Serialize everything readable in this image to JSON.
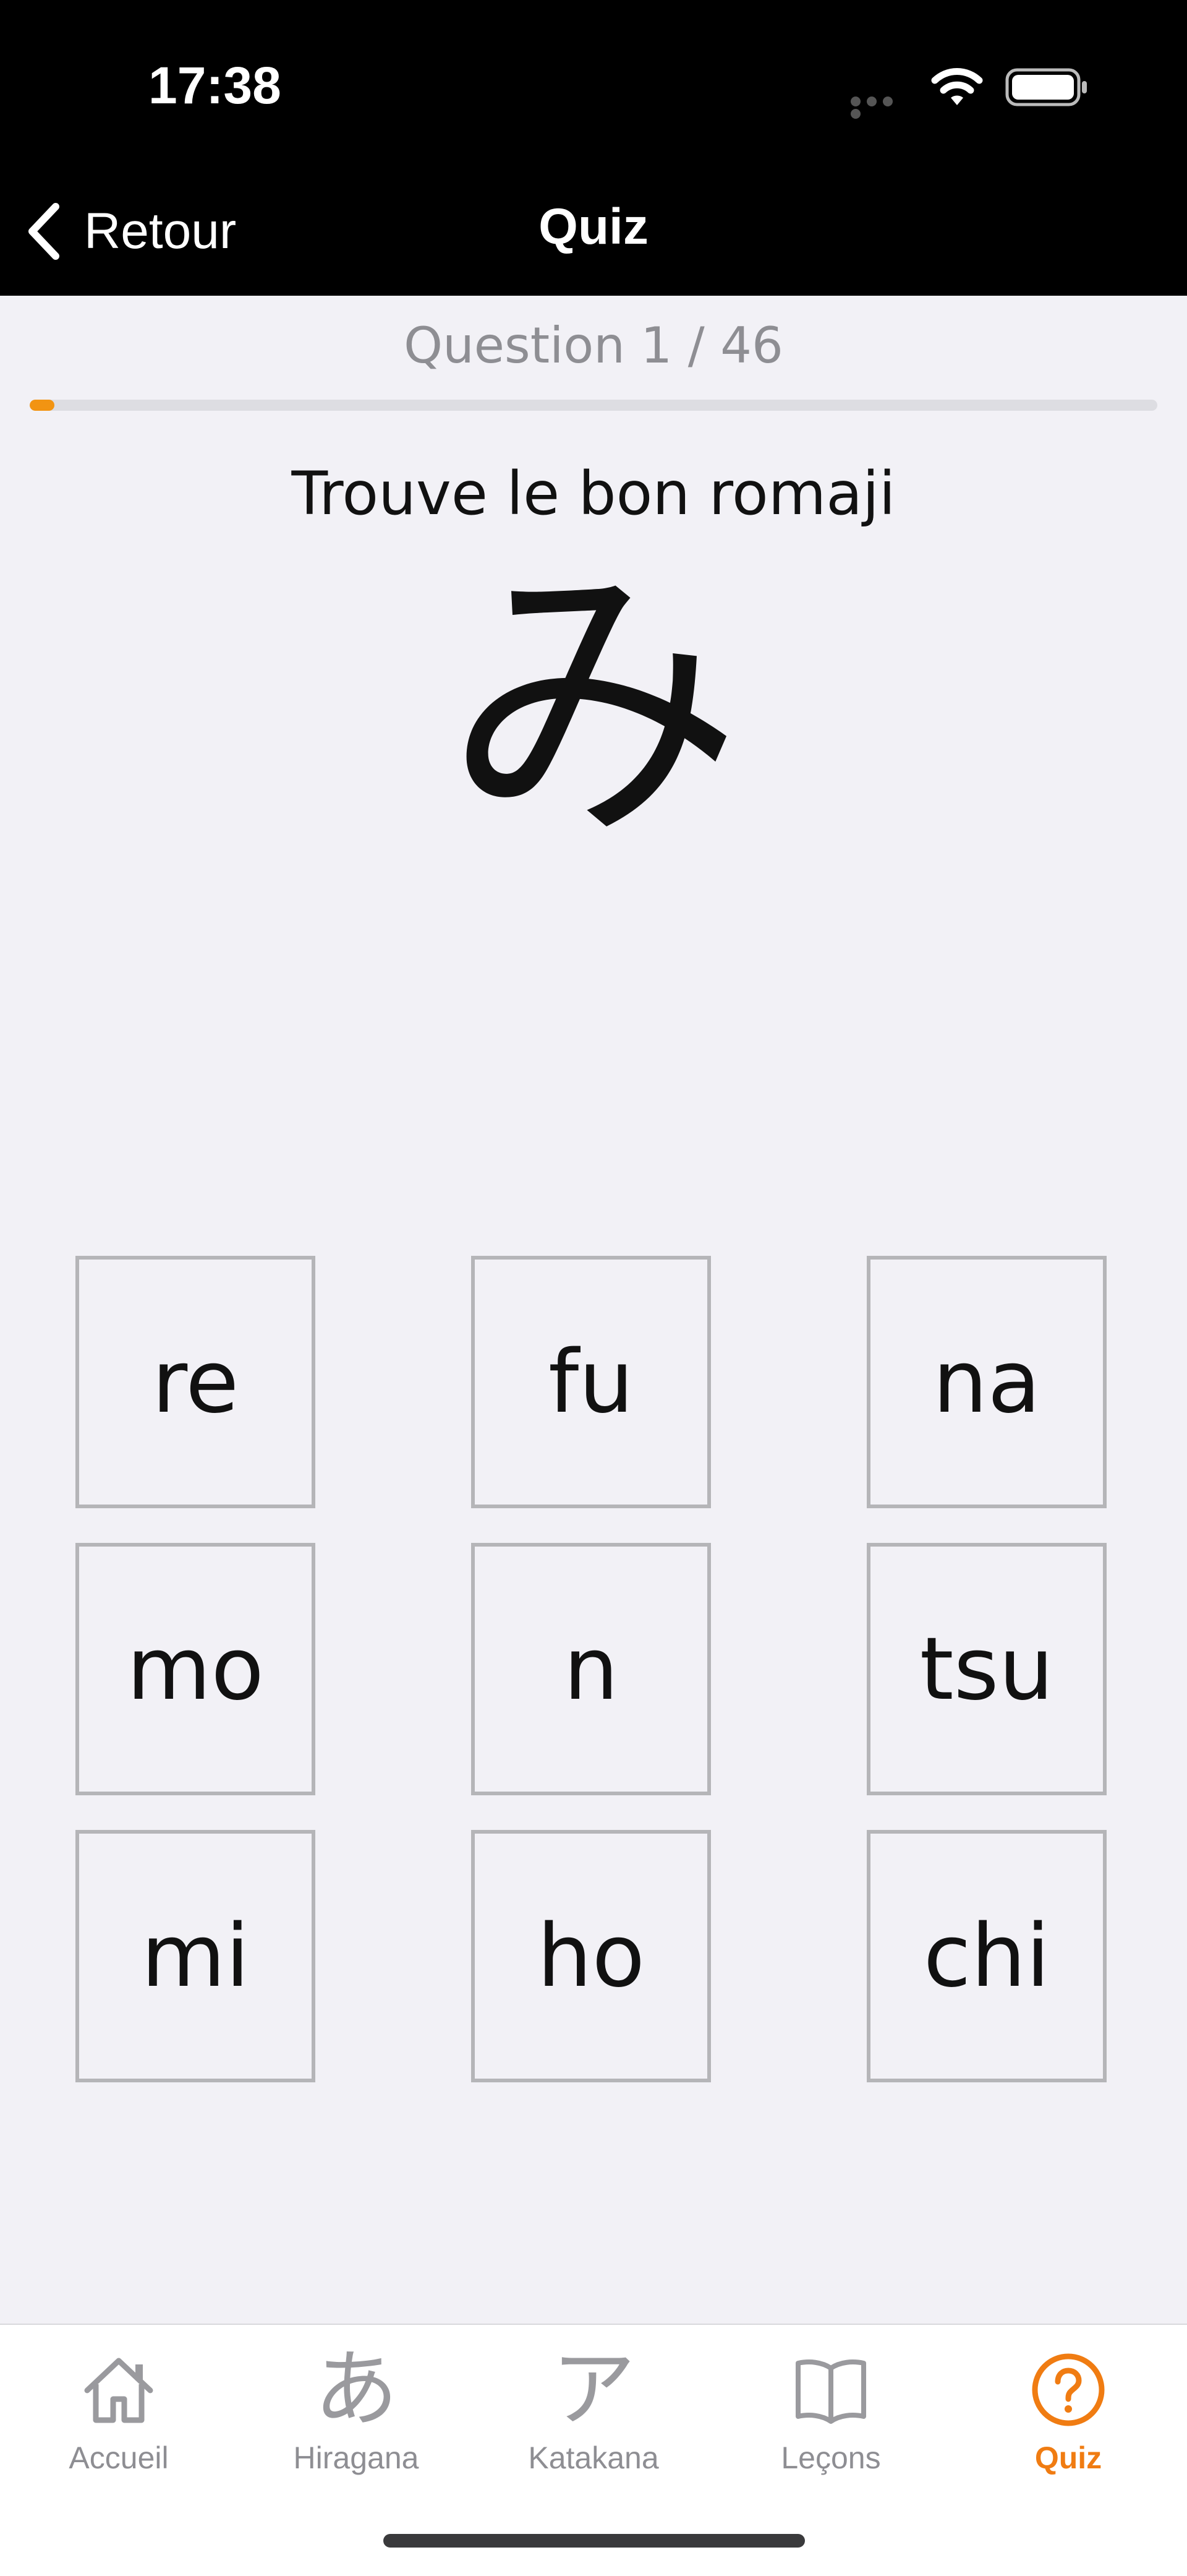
{
  "status": {
    "time": "17:38"
  },
  "nav": {
    "back_label": "Retour",
    "title": "Quiz"
  },
  "quiz": {
    "counter": "Question 1 / 46",
    "progress_fraction": 0.0217,
    "prompt": "Trouve le bon romaji",
    "kana": "み",
    "answers": [
      "re",
      "fu",
      "na",
      "mo",
      "n",
      "tsu",
      "mi",
      "ho",
      "chi"
    ]
  },
  "tabs": [
    {
      "label": "Accueil",
      "icon": "home-icon",
      "active": false
    },
    {
      "label": "Hiragana",
      "icon": "hiragana-a-icon",
      "glyph": "あ",
      "active": false
    },
    {
      "label": "Katakana",
      "icon": "katakana-a-icon",
      "glyph": "ア",
      "active": false
    },
    {
      "label": "Leçons",
      "icon": "book-icon",
      "active": false
    },
    {
      "label": "Quiz",
      "icon": "question-circle-icon",
      "active": true
    }
  ],
  "colors": {
    "accent": "#f07c12",
    "progress": "#f29412",
    "background": "#f2f1f6",
    "inactive_tab": "#8e8e93"
  }
}
